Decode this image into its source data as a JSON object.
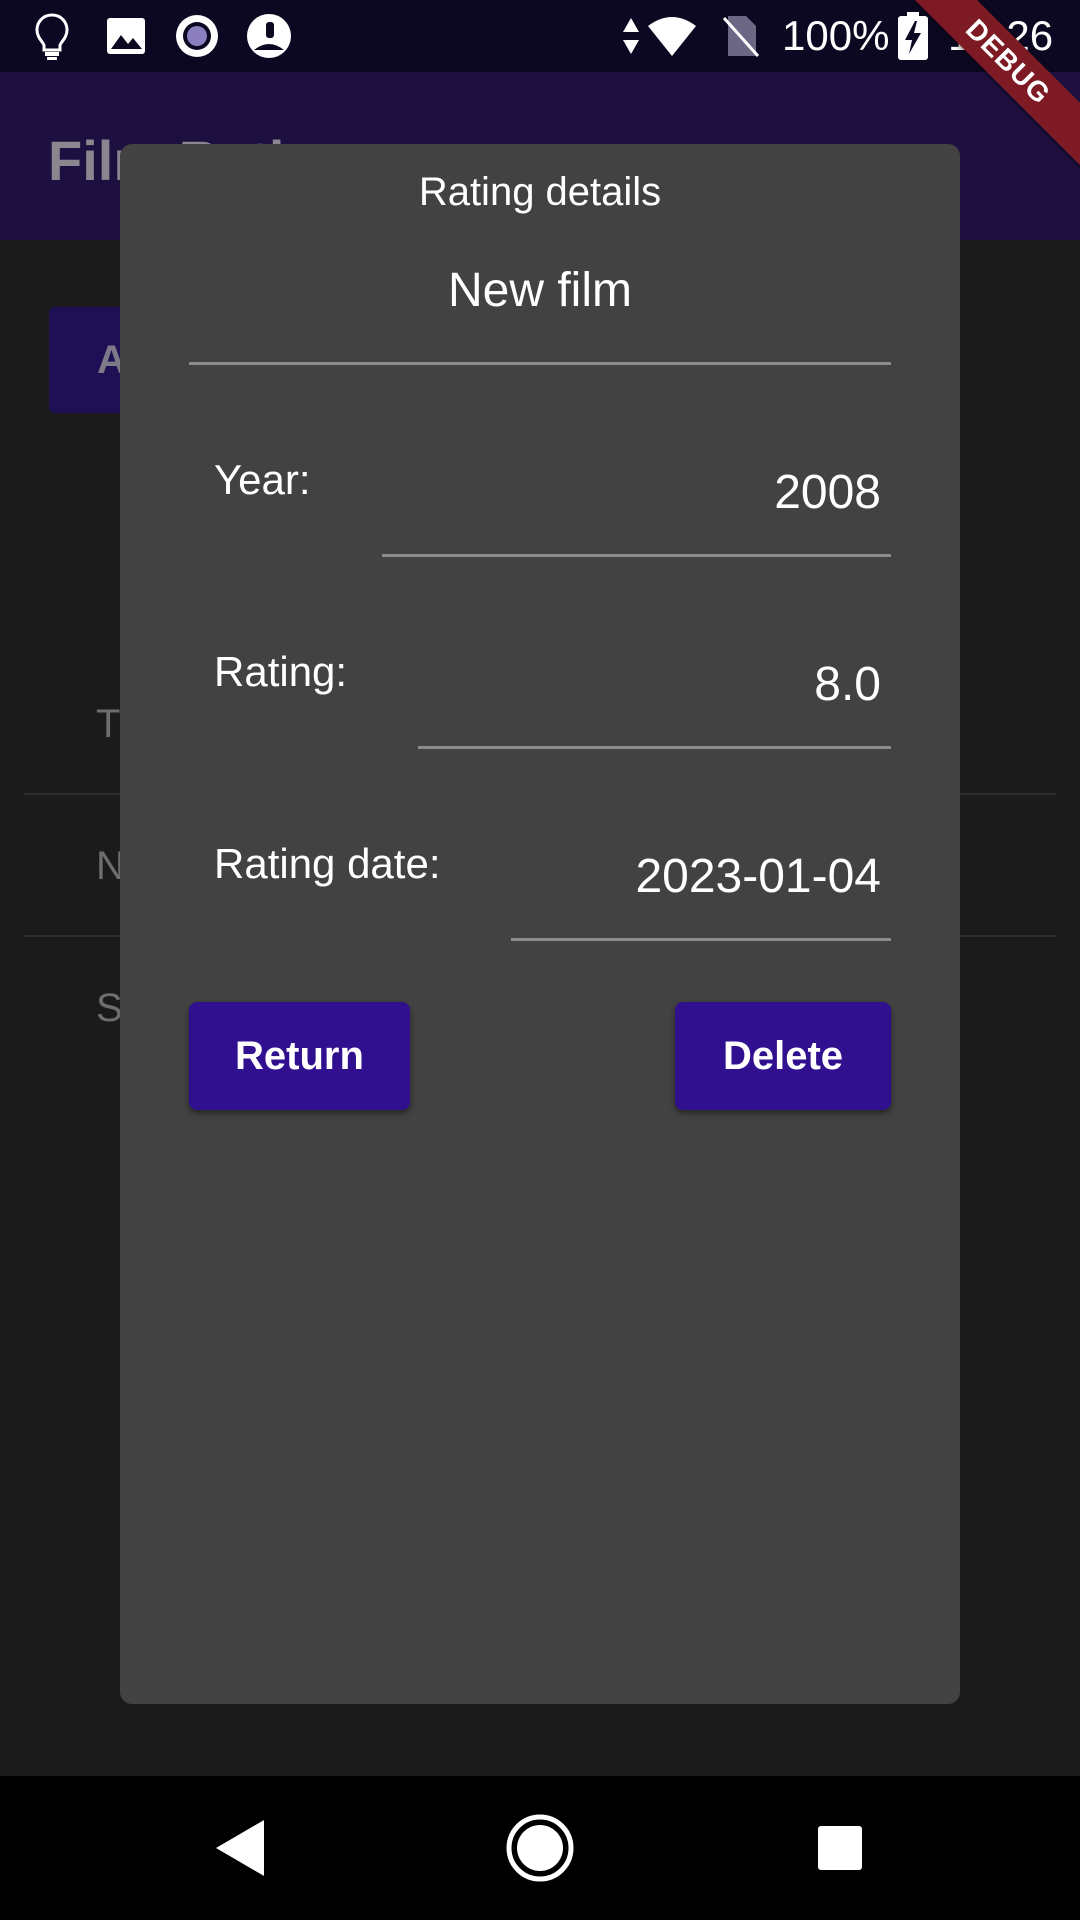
{
  "status_bar": {
    "icons": [
      "lightbulb-icon",
      "image-icon",
      "record-icon",
      "owl-avatar-icon",
      "data-arrows-icon",
      "wifi-icon",
      "no-sim-icon",
      "battery-charging-icon"
    ],
    "battery": "100%",
    "time": "17:26"
  },
  "debug_banner": "DEBUG",
  "app_bar": {
    "title": "Film Ratings"
  },
  "background": {
    "button_label": "A",
    "rows": [
      "T",
      "N",
      "S"
    ]
  },
  "dialog": {
    "title": "Rating details",
    "film_name": "New film",
    "year_label": "Year:",
    "year_value": "2008",
    "rating_label": "Rating:",
    "rating_value": "8.0",
    "rating_date_label": "Rating date:",
    "rating_date_value": "2023-01-04",
    "return_label": "Return",
    "delete_label": "Delete"
  },
  "colors": {
    "accent": "#31108f",
    "dialog_bg": "#424242",
    "app_bar_bg": "#1d0f40",
    "debug_banner": "#7d1a24"
  },
  "nav_bar": {
    "icons": [
      "back-icon",
      "home-icon",
      "recents-icon"
    ]
  }
}
